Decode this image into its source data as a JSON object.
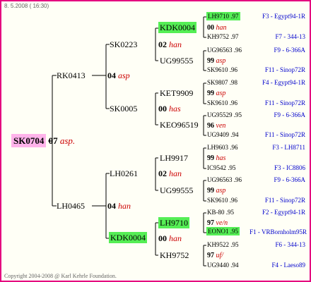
{
  "header": {
    "date": "8. 5.2008 ( 16:30)"
  },
  "footer": {
    "copyright": "Copyright 2004-2008 @ Karl Kehrle Foundation."
  },
  "colors": {
    "border": "#e4007f",
    "highlight_green": "#55ee55",
    "highlight_pink": "#ffb3ea",
    "mate_red": "#cc0000",
    "origin_blue": "#0000cc"
  },
  "root": {
    "id": "SK0704",
    "num": "07",
    "mate": "asp."
  },
  "gen1": [
    {
      "id": "RK0413",
      "num": "04",
      "mate": "asp"
    },
    {
      "id": "LH0465",
      "num": "04",
      "mate": "han"
    }
  ],
  "gen2": [
    {
      "id": "SK0223",
      "num": "02",
      "mate": "han"
    },
    {
      "id": "SK0005",
      "num": "00",
      "mate": "has"
    },
    {
      "id": "LH0261",
      "num": "02",
      "mate": "han"
    },
    {
      "id": "KDK0004",
      "num": "00",
      "mate": "han"
    }
  ],
  "gen3": [
    {
      "id": "KDK0004",
      "num": "00",
      "mate": "han"
    },
    {
      "id": "UG99555",
      "num": "99",
      "mate": "asp"
    },
    {
      "id": "KET9909",
      "num": "99",
      "mate": "asp"
    },
    {
      "id": "KEO96519",
      "num": "96",
      "mate": "ven"
    },
    {
      "id": "LH9917",
      "num": "99",
      "mate": "has"
    },
    {
      "id": "UG99555",
      "num": "99",
      "mate": "asp"
    },
    {
      "id": "LH9710",
      "num": "97",
      "mate": "ve/n"
    },
    {
      "id": "KH9752",
      "num": "97",
      "mate": "uf/"
    }
  ],
  "gen4": [
    {
      "id": "LH9710 .97",
      "origin": "F3 - Egypt94-1R"
    },
    {
      "id": "KH9752 .97",
      "origin": "F7 - 344-13"
    },
    {
      "id": "UG96563 .96",
      "origin": "F9 - 6-366A"
    },
    {
      "id": "SK9610 .96",
      "origin": "F11 - Sinop72R"
    },
    {
      "id": "SK9807 .98",
      "origin": "F4 - Egypt94-1R"
    },
    {
      "id": "SK9610 .96",
      "origin": "F11 - Sinop72R"
    },
    {
      "id": "UG95529 .95",
      "origin": "F9 - 6-366A"
    },
    {
      "id": "UG9409 .94",
      "origin": "F11 - Sinop72R"
    },
    {
      "id": "LH9603 .96",
      "origin": "F3 - LH8711"
    },
    {
      "id": "IC9542 .95",
      "origin": "F3 - IC8806"
    },
    {
      "id": "UG96563 .96",
      "origin": "F9 - 6-366A"
    },
    {
      "id": "SK9610 .96",
      "origin": "F11 - Sinop72R"
    },
    {
      "id": "KB-80 .95",
      "origin": "F2 - Egypt94-1R"
    },
    {
      "id": "EONO1 .95",
      "origin": "F1 - VRBornholm95R"
    },
    {
      "id": "KH9522 .95",
      "origin": "F6 - 344-13"
    },
    {
      "id": "UG9440 .94",
      "origin": "F4 - Laeso89"
    }
  ]
}
